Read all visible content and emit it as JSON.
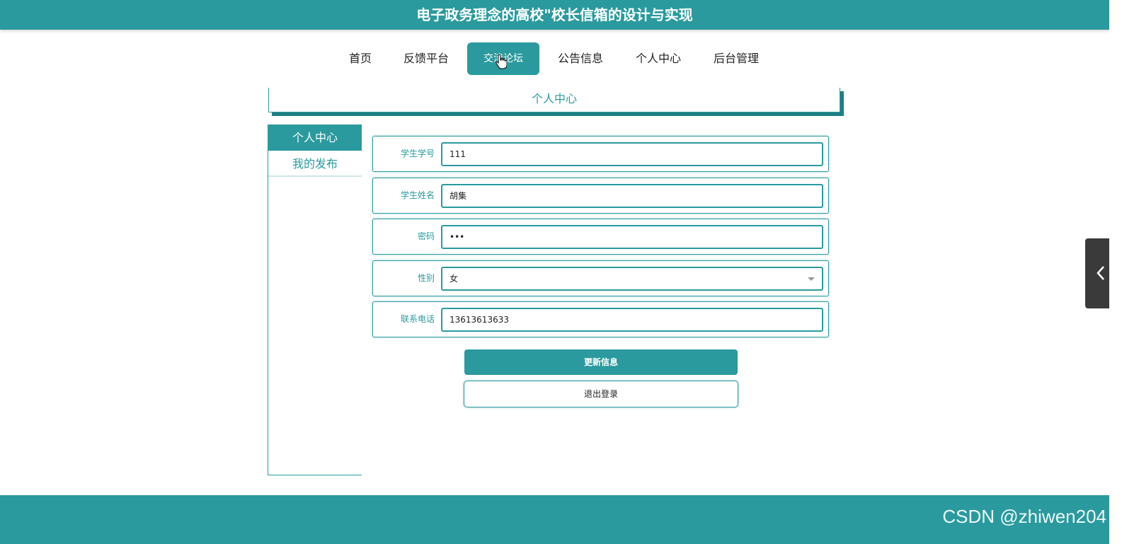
{
  "header": {
    "title": "电子政务理念的高校\"校长信箱的设计与实现"
  },
  "nav": {
    "items": [
      {
        "label": "首页"
      },
      {
        "label": "反馈平台"
      },
      {
        "label": "交流论坛"
      },
      {
        "label": "公告信息"
      },
      {
        "label": "个人中心"
      },
      {
        "label": "后台管理"
      }
    ],
    "active": "交流论坛"
  },
  "section": {
    "title": "个人中心"
  },
  "sidebar": {
    "items": [
      {
        "label": "个人中心"
      },
      {
        "label": "我的发布"
      }
    ],
    "active": "个人中心"
  },
  "form": {
    "student_id": {
      "label": "学生学号",
      "value": "111"
    },
    "student_name": {
      "label": "学生姓名",
      "value": "胡集"
    },
    "password": {
      "label": "密码",
      "value": "•••"
    },
    "gender": {
      "label": "性别",
      "value": "女"
    },
    "phone": {
      "label": "联系电话",
      "value": "13613613633"
    }
  },
  "buttons": {
    "update": "更新信息",
    "logout": "退出登录"
  },
  "watermark": "CSDN @zhiwen204",
  "colors": {
    "primary": "#2a9a9e",
    "shadow": "#1f7f83",
    "side_tab": "#3a3a3a"
  },
  "icons": {
    "cursor": "hand-cursor-icon",
    "side_tab": "chevron-left-icon"
  }
}
